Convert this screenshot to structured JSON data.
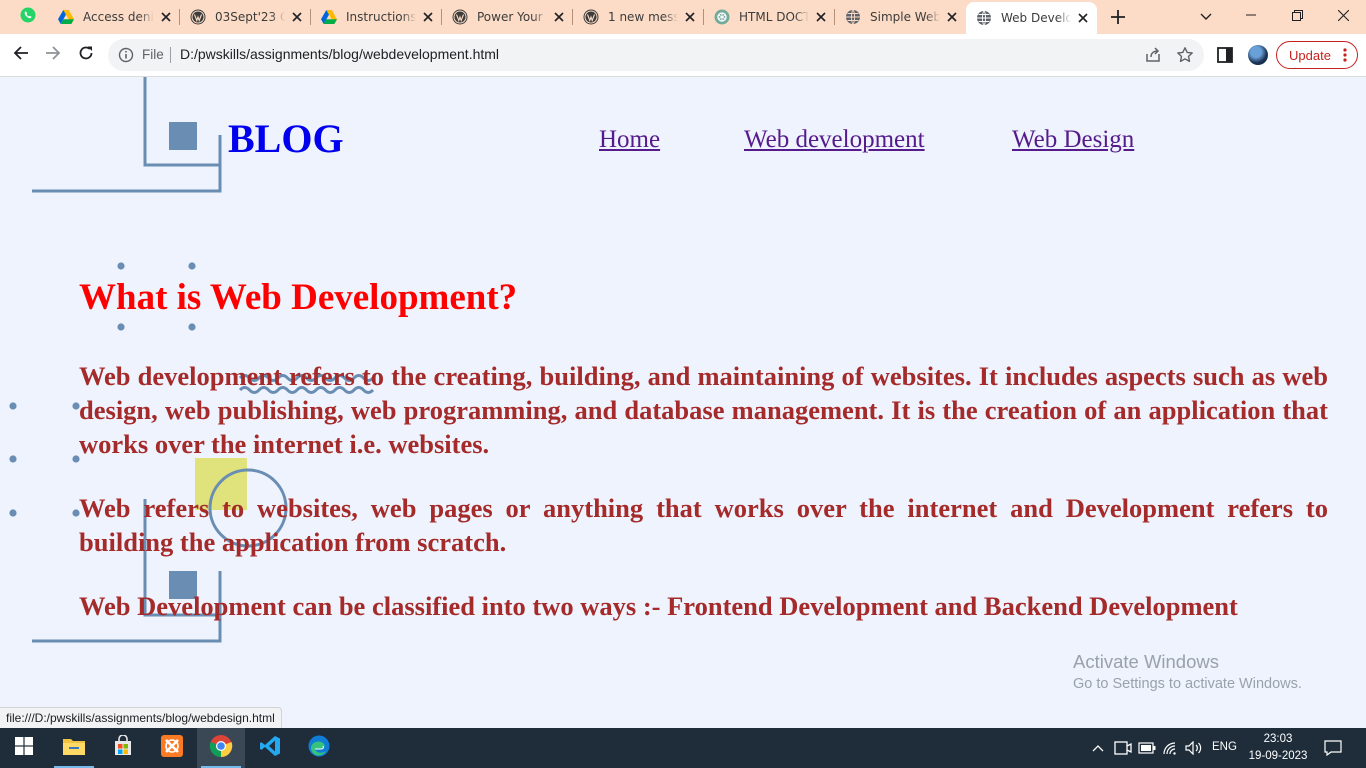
{
  "browser": {
    "tabs": [
      {
        "title": "Access denie",
        "icon": "google-drive-icon"
      },
      {
        "title": "03Sept'23 Cl",
        "icon": "wordpress-icon"
      },
      {
        "title": "Instructions f",
        "icon": "google-drive-icon"
      },
      {
        "title": "Power Your S",
        "icon": "wordpress-icon"
      },
      {
        "title": "1 new messa",
        "icon": "wordpress-icon"
      },
      {
        "title": "HTML DOCT",
        "icon": "chatgpt-icon"
      },
      {
        "title": "Simple Web",
        "icon": "globe-icon"
      },
      {
        "title": "Web Develop",
        "icon": "globe-icon",
        "active": true
      }
    ],
    "pinned_tab_icon": "whatsapp-icon",
    "address": {
      "scheme_label": "File",
      "url": "D:/pwskills/assignments/blog/webdevelopment.html"
    },
    "update_label": "Update",
    "status_url": "file:///D:/pwskills/assignments/blog/webdesign.html"
  },
  "page": {
    "logo": "BLOG",
    "nav": [
      "Home",
      "Web development",
      "Web Design"
    ],
    "heading": "What is Web Development?",
    "paragraphs": [
      "Web development refers to the creating, building, and maintaining of websites. It includes aspects such as web design, web publishing, web programming, and database management. It is the creation of an application that works over the internet i.e. websites.",
      "Web refers to websites, web pages or anything that works over the internet and Development refers to building the application from scratch.",
      "Web Development can be classified into two ways :- Frontend Development and Backend Development"
    ],
    "colors": {
      "logo": "#0000ee",
      "nav": "#551a8b",
      "heading": "#ff0000",
      "body_text": "#a52a2a",
      "decoration": "#6a8db3",
      "background": "#eef3fd"
    }
  },
  "watermark": {
    "line1": "Activate Windows",
    "line2": "Go to Settings to activate Windows."
  },
  "taskbar": {
    "apps": [
      "windows-start-icon",
      "file-explorer-icon",
      "microsoft-store-icon",
      "xampp-icon",
      "chrome-icon",
      "vscode-icon",
      "edge-icon"
    ],
    "language": "ENG",
    "time": "23:03",
    "date": "19-09-2023"
  }
}
